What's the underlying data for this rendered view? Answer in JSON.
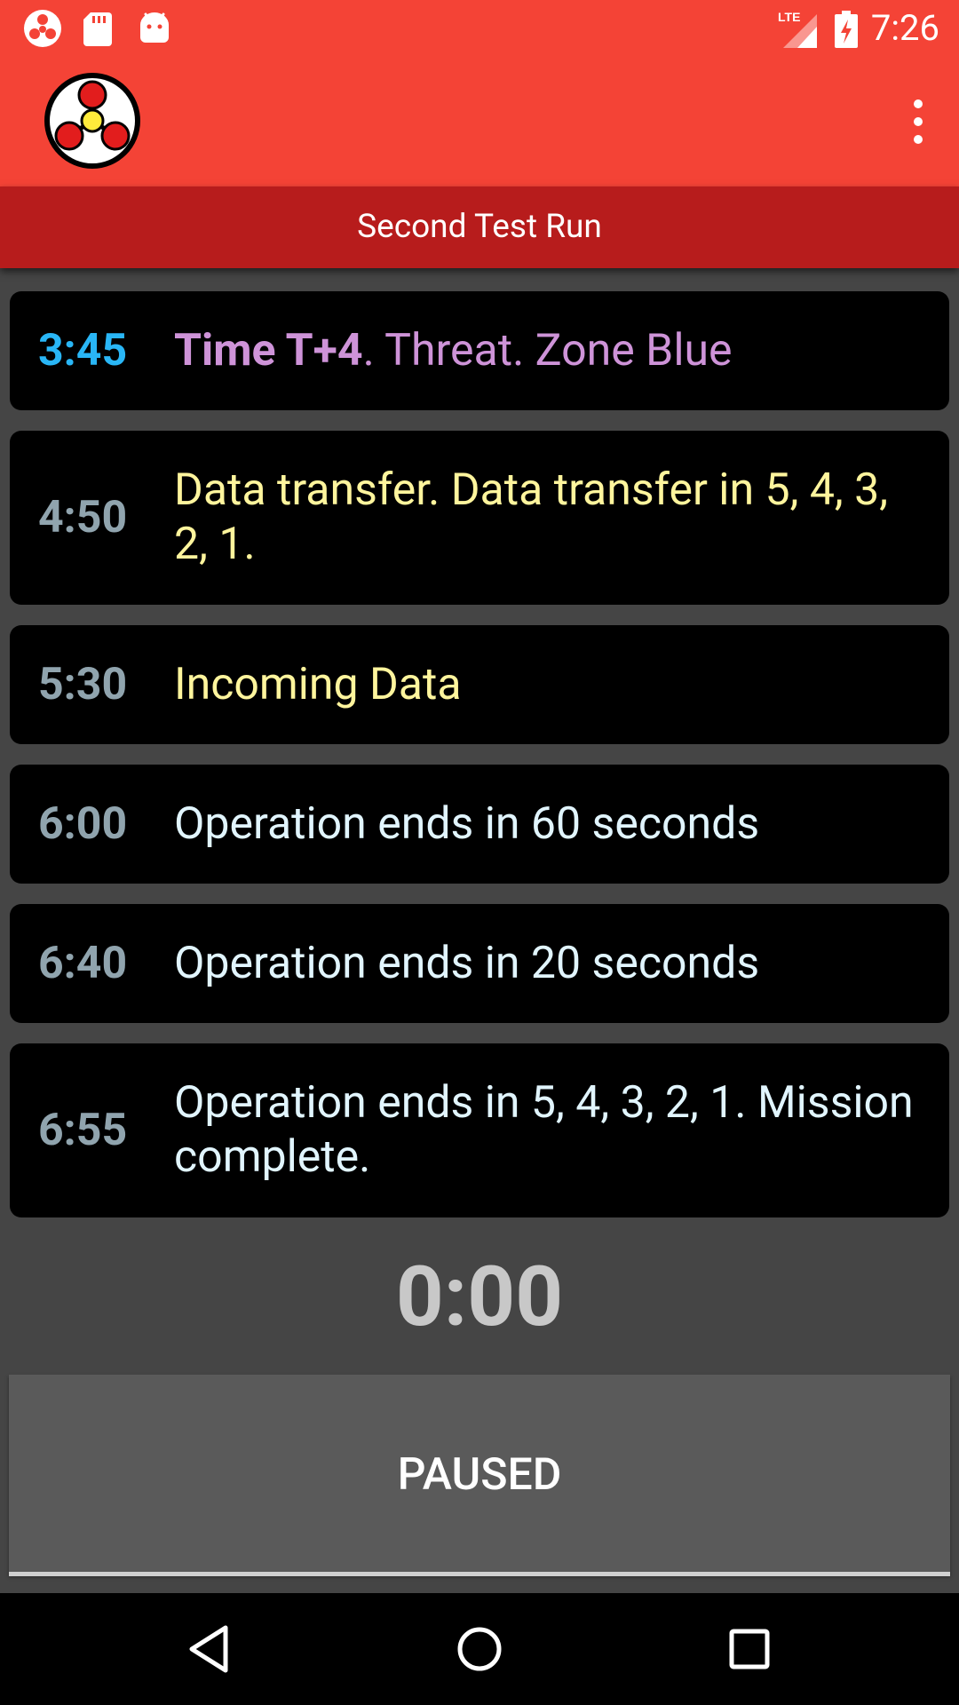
{
  "status_bar": {
    "time": "7:26",
    "network_label": "LTE",
    "left_icons": [
      "app-notification-icon",
      "sd-card-icon",
      "android-debug-icon"
    ],
    "right_icons": [
      "lte-signal-icon",
      "battery-charging-icon"
    ]
  },
  "app_bar": {
    "logo_icon": "hazard-logo-icon",
    "overflow_icon": "overflow-menu-icon"
  },
  "subtitle": "Second Test Run",
  "schedule": [
    {
      "time": "3:45",
      "time_color": "#29B6F6",
      "msg_color": "#CE93D8",
      "msg_bold": "Time T+4",
      "msg": ". Threat. Zone Blue"
    },
    {
      "time": "4:50",
      "time_color": "#90A4AE",
      "msg_color": "#FFF59D",
      "msg_bold": "",
      "msg": "Data transfer. Data transfer in 5, 4, 3, 2, 1."
    },
    {
      "time": "5:30",
      "time_color": "#90A4AE",
      "msg_color": "#FFF59D",
      "msg_bold": "",
      "msg": "Incoming Data"
    },
    {
      "time": "6:00",
      "time_color": "#90A4AE",
      "msg_color": "#E1F5FE",
      "msg_bold": "",
      "msg": "Operation ends in 60 seconds"
    },
    {
      "time": "6:40",
      "time_color": "#90A4AE",
      "msg_color": "#E1F5FE",
      "msg_bold": "",
      "msg": "Operation ends in 20 seconds"
    },
    {
      "time": "6:55",
      "time_color": "#90A4AE",
      "msg_color": "#E1F5FE",
      "msg_bold": "",
      "msg": "Operation ends in 5, 4, 3, 2, 1. Mission complete."
    }
  ],
  "timer": "0:00",
  "paused_button": {
    "label": "PAUSED"
  },
  "nav_bar": {
    "icons": [
      "back-icon",
      "home-icon",
      "recents-icon"
    ]
  },
  "colors": {
    "primary": "#F44336",
    "primary_dark": "#B71C1C",
    "background": "#454545",
    "card": "#000000",
    "button": "#5A5A5A"
  }
}
